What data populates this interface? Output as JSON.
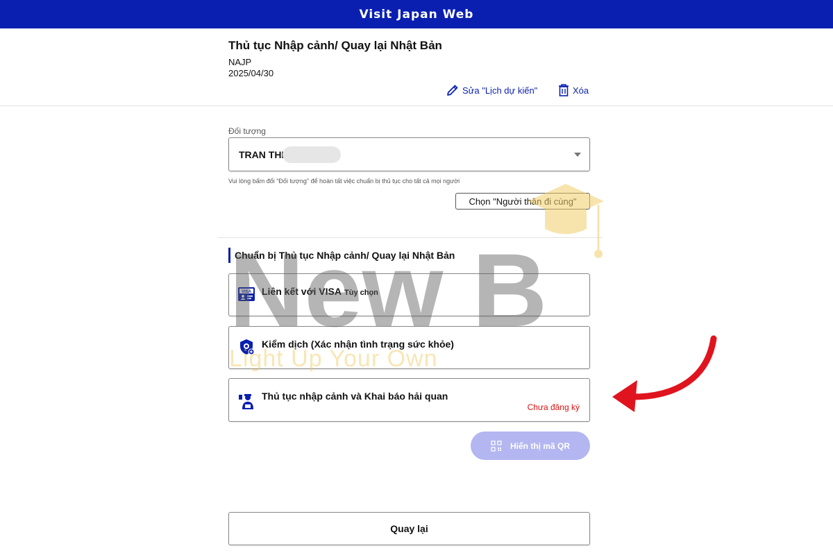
{
  "app": {
    "title": "Visit Japan Web"
  },
  "procedure": {
    "title": "Thủ tục Nhập cảnh/ Quay lại Nhật Bản",
    "code": "NAJP",
    "date": "2025/04/30",
    "edit_label": "Sửa \"Lịch dự kiến\"",
    "delete_label": "Xóa"
  },
  "subject": {
    "label": "Đối tượng",
    "value": "TRAN THI",
    "hint": "Vui lòng bấm đổi \"Đối tượng\" để hoàn tất việc chuẩn bị thủ tục cho tất cả mọi người",
    "companion_button": "Chọn \"Người thân đi cùng\""
  },
  "section": {
    "title": "Chuẩn bị Thủ tục Nhập cảnh/ Quay lại Nhật Bản",
    "cards": [
      {
        "label": "Liên kết với VISA",
        "optional": "Tùy chọn",
        "icon": "visa-card-icon",
        "status": ""
      },
      {
        "label": "Kiểm dịch (Xác nhận tình trạng sức khỏe)",
        "optional": "",
        "icon": "quarantine-shield-icon",
        "status": ""
      },
      {
        "label": "Thủ tục nhập cảnh và Khai báo hải quan",
        "optional": "",
        "icon": "immigration-officer-icon",
        "status": "Chưa đăng ký"
      }
    ]
  },
  "qr_button": {
    "label": "Hiển thị mã QR",
    "icon": "qr-code-icon"
  },
  "back_button": {
    "label": "Quay lại"
  },
  "watermark": {
    "text": "New B",
    "slogan": "Light Up Your Own"
  },
  "colors": {
    "brand": "#0a1fb0",
    "status_red": "#dd1111",
    "qr_disabled": "#b3b6f0",
    "arrow": "#e0141e"
  }
}
